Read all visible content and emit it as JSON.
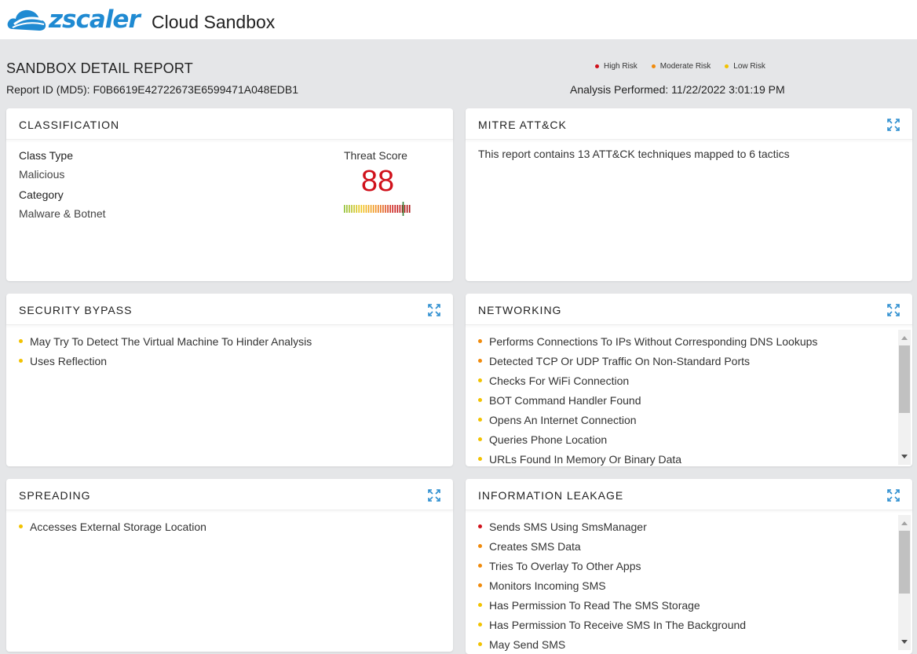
{
  "header": {
    "brand": "zscaler",
    "app_title": "Cloud Sandbox"
  },
  "report": {
    "title": "SANDBOX DETAIL REPORT",
    "report_id": "Report ID (MD5): F0B6619E42722673E6599471A048EDB1",
    "analysis": "Analysis Performed: 11/22/2022 3:01:19 PM"
  },
  "legend": [
    {
      "label": "High Risk",
      "color": "#d0111b"
    },
    {
      "label": "Moderate Risk",
      "color": "#f08a0b"
    },
    {
      "label": "Low Risk",
      "color": "#f2c200"
    }
  ],
  "classification": {
    "title": "CLASSIFICATION",
    "class_type_label": "Class Type",
    "class_type_value": "Malicious",
    "category_label": "Category",
    "category_value": "Malware & Botnet",
    "threat_score_label": "Threat Score",
    "threat_score": "88",
    "threat_score_fraction": 0.88
  },
  "mitre": {
    "title": "MITRE ATT&CK",
    "summary": "This report contains 13 ATT&CK techniques mapped to 6 tactics",
    "icon": "expand-icon"
  },
  "security_bypass": {
    "title": "SECURITY BYPASS",
    "items": [
      {
        "text": "May Try To Detect The Virtual Machine To Hinder Analysis",
        "risk": "low"
      },
      {
        "text": "Uses Reflection",
        "risk": "low"
      }
    ]
  },
  "networking": {
    "title": "NETWORKING",
    "items": [
      {
        "text": "Performs Connections To IPs Without Corresponding DNS Lookups",
        "risk": "moderate"
      },
      {
        "text": "Detected TCP Or UDP Traffic On Non-Standard Ports",
        "risk": "moderate"
      },
      {
        "text": "Checks For WiFi Connection",
        "risk": "low"
      },
      {
        "text": "BOT Command Handler Found",
        "risk": "low"
      },
      {
        "text": "Opens An Internet Connection",
        "risk": "low"
      },
      {
        "text": "Queries Phone Location",
        "risk": "low"
      },
      {
        "text": "URLs Found In Memory Or Binary Data",
        "risk": "low"
      }
    ]
  },
  "spreading": {
    "title": "SPREADING",
    "items": [
      {
        "text": "Accesses External Storage Location",
        "risk": "low"
      }
    ]
  },
  "information_leakage": {
    "title": "INFORMATION LEAKAGE",
    "items": [
      {
        "text": "Sends SMS Using SmsManager",
        "risk": "high"
      },
      {
        "text": "Creates SMS Data",
        "risk": "moderate"
      },
      {
        "text": "Tries To Overlay To Other Apps",
        "risk": "moderate"
      },
      {
        "text": "Monitors Incoming SMS",
        "risk": "moderate"
      },
      {
        "text": "Has Permission To Read The SMS Storage",
        "risk": "low"
      },
      {
        "text": "Has Permission To Receive SMS In The Background",
        "risk": "low"
      },
      {
        "text": "May Send SMS",
        "risk": "low"
      }
    ]
  },
  "colors": {
    "brand": "#1f8ad2",
    "high": "#d0111b",
    "moderate": "#f08a0b",
    "low": "#f2c200",
    "expand_icon": "#2f8fd0"
  }
}
